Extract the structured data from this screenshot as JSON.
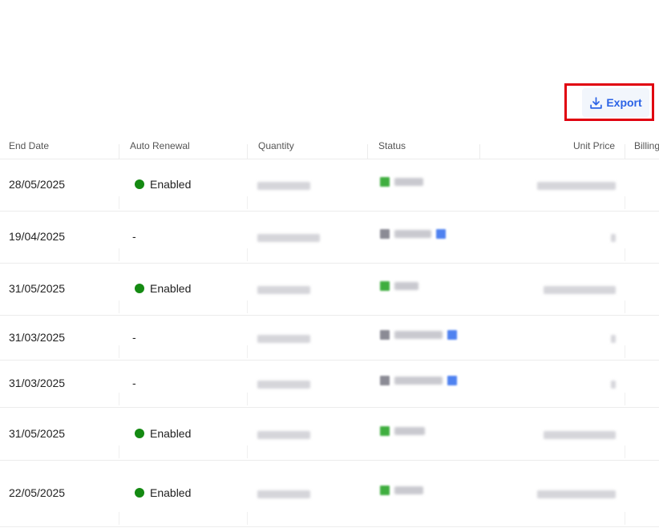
{
  "toolbar": {
    "export_label": "Export",
    "export_icon": "download-icon",
    "accent_color": "#2b63e6",
    "highlight_color": "#e0000f"
  },
  "table": {
    "columns": [
      "End Date",
      "Auto Renewal",
      "Quantity",
      "Status",
      "Unit Price",
      "Billing"
    ],
    "rows": [
      {
        "end_date": "28/05/2025",
        "auto_renewal": "Enabled",
        "auto_renewal_on": true,
        "status_color": "green",
        "status_tag": false,
        "price_visible": true
      },
      {
        "end_date": "19/04/2025",
        "auto_renewal": "-",
        "auto_renewal_on": false,
        "status_color": "grey",
        "status_tag": true,
        "price_visible": false
      },
      {
        "end_date": "31/05/2025",
        "auto_renewal": "Enabled",
        "auto_renewal_on": true,
        "status_color": "green",
        "status_tag": false,
        "price_visible": true
      },
      {
        "end_date": "31/03/2025",
        "auto_renewal": "-",
        "auto_renewal_on": false,
        "status_color": "grey",
        "status_tag": true,
        "price_visible": false
      },
      {
        "end_date": "31/03/2025",
        "auto_renewal": "-",
        "auto_renewal_on": false,
        "status_color": "grey",
        "status_tag": true,
        "price_visible": false
      },
      {
        "end_date": "31/05/2025",
        "auto_renewal": "Enabled",
        "auto_renewal_on": true,
        "status_color": "green",
        "status_tag": false,
        "price_visible": true
      },
      {
        "end_date": "22/05/2025",
        "auto_renewal": "Enabled",
        "auto_renewal_on": true,
        "status_color": "green",
        "status_tag": false,
        "price_visible": true
      }
    ]
  },
  "colors": {
    "enabled_dot": "#148a12",
    "border": "#ececec",
    "header_text": "#555555"
  }
}
